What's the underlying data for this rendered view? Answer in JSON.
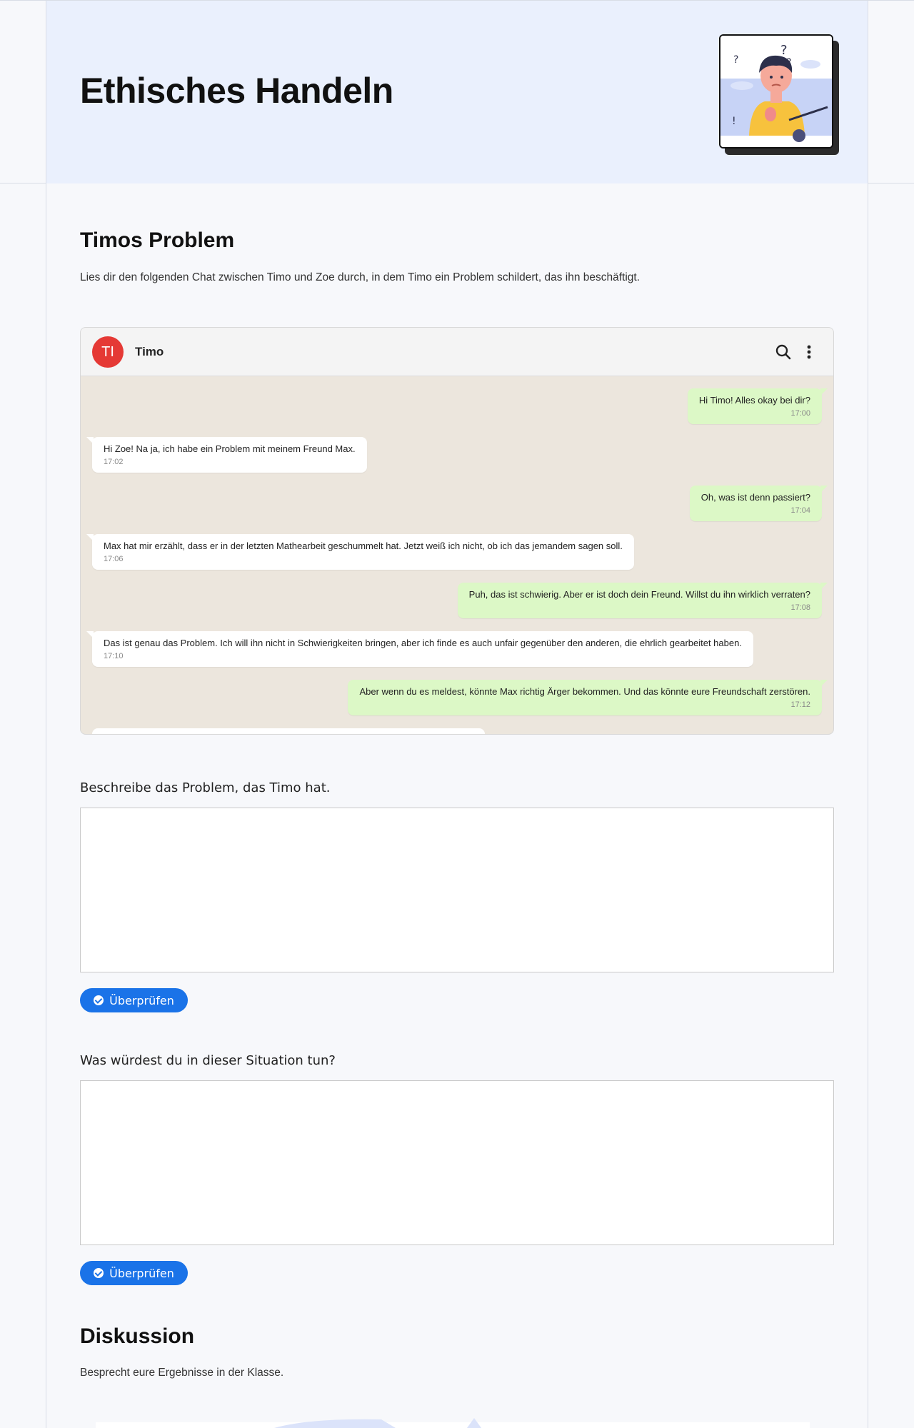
{
  "header": {
    "title": "Ethisches Handeln",
    "image_icon": "confused-person-illustration"
  },
  "section1": {
    "heading": "Timos Problem",
    "intro": "Lies dir den folgenden Chat zwischen Timo und Zoe durch, in dem Timo ein Problem schildert, das ihn beschäftigt."
  },
  "chat": {
    "avatar_initials": "TI",
    "avatar_color": "#e53935",
    "contact_name": "Timo",
    "incoming_bg": "#ffffff",
    "outgoing_bg": "#dcf8c6",
    "messages": [
      {
        "direction": "out",
        "text": "Hi Timo! Alles okay bei dir?",
        "time": "17:00"
      },
      {
        "direction": "in",
        "text": "Hi Zoe! Na ja, ich habe ein Problem mit meinem Freund Max.",
        "time": "17:02"
      },
      {
        "direction": "out",
        "text": "Oh, was ist denn passiert?",
        "time": "17:04"
      },
      {
        "direction": "in",
        "text": "Max hat mir erzählt, dass er in der letzten Mathearbeit geschummelt hat. Jetzt weiß ich nicht, ob ich das jemandem sagen soll.",
        "time": "17:06"
      },
      {
        "direction": "out",
        "text": "Puh, das ist schwierig. Aber er ist doch dein Freund. Willst du ihn wirklich verraten?",
        "time": "17:08"
      },
      {
        "direction": "in",
        "text": "Das ist genau das Problem. Ich will ihn nicht in Schwierigkeiten bringen, aber ich finde es auch unfair gegenüber den anderen, die ehrlich gearbeitet haben.",
        "time": "17:10"
      },
      {
        "direction": "out",
        "text": "Aber wenn du es meldest, könnte Max richtig Ärger bekommen. Und das könnte eure Freundschaft zerstören.",
        "time": "17:12"
      }
    ]
  },
  "question1": {
    "label": "Beschreibe das Problem, das Timo hat.",
    "value": "",
    "button_label": "Überprüfen"
  },
  "question2": {
    "label": "Was würdest du in dieser Situation tun?",
    "value": "",
    "button_label": "Überprüfen"
  },
  "discussion": {
    "heading": "Diskussion",
    "text": "Besprecht eure Ergebnisse in der Klasse."
  },
  "colors": {
    "accent": "#1a73e8",
    "header_bg": "#eaf0fd",
    "chat_bg": "#ece6dd"
  }
}
